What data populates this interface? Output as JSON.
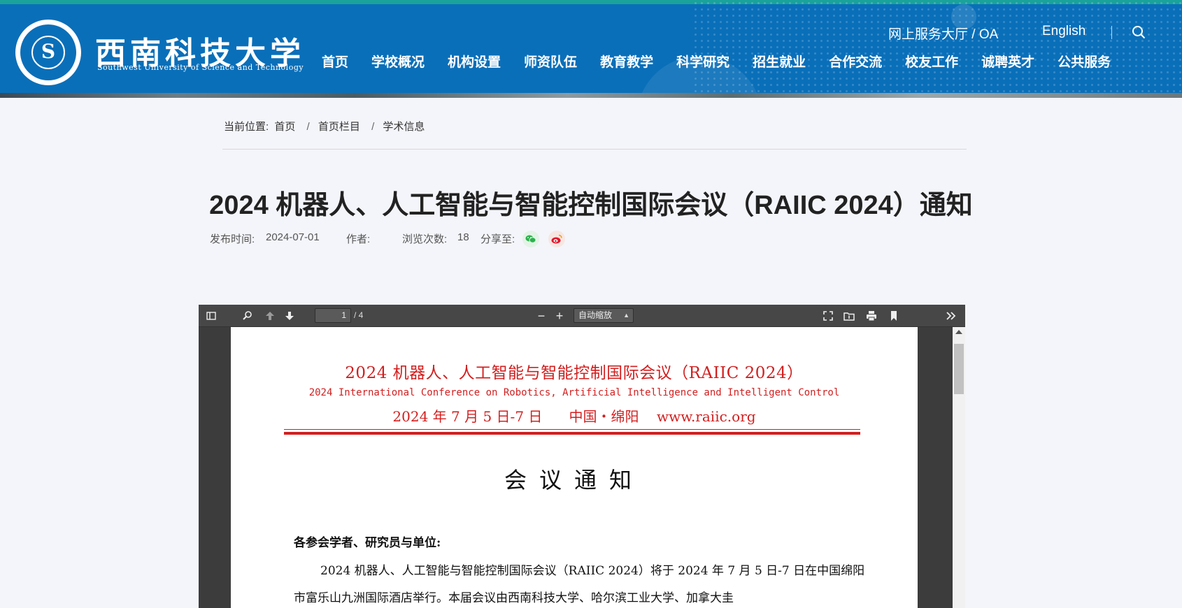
{
  "header": {
    "school_name_cn": "西南科技大学",
    "school_name_en": "Southwest University of Science and Technology",
    "logo_letter": "S",
    "service_link": "网上服务大厅 / OA",
    "english_link": "English",
    "nav": [
      "首页",
      "学校概况",
      "机构设置",
      "师资队伍",
      "教育教学",
      "科学研究",
      "招生就业",
      "合作交流",
      "校友工作",
      "诚聘英才",
      "公共服务"
    ]
  },
  "breadcrumb": {
    "prefix": "当前位置:",
    "items": [
      "首页",
      "首页栏目",
      "学术信息"
    ],
    "separator": "/"
  },
  "article": {
    "title": "2024 机器人、人工智能与智能控制国际会议（RAIIC 2024）通知",
    "publish_label": "发布时间:",
    "publish_date": "2024-07-01",
    "author_label": "作者:",
    "author": "",
    "views_label": "浏览次数:",
    "views": "18",
    "share_label": "分享至:"
  },
  "pdf_viewer": {
    "current_page": "1",
    "total_pages": "/ 4",
    "zoom": "自动缩放",
    "document": {
      "title": "2024 机器人、人工智能与智能控制国际会议（RAIIC 2024）",
      "subtitle_en": "2024 International Conference on Robotics, Artificial Intelligence and Intelligent Control",
      "date_place_url": "2024 年 7 月 5 日-7 日      中国・绵阳    www.raiic.org",
      "heading": "会议通知",
      "salutation": "各参会学者、研究员与单位:",
      "paragraph": "2024 机器人、人工智能与智能控制国际会议（RAIIC 2024）将于 2024 年 7 月 5 日-7 日在中国绵阳市富乐山九洲国际酒店举行。本届会议由西南科技大学、哈尔滨工业大学、加拿大圭"
    }
  },
  "colors": {
    "header_blue": "#0a6fb9",
    "accent_teal": "#1aa39a",
    "doc_red": "#d21f1f",
    "page_bg": "#f4f5fa"
  }
}
